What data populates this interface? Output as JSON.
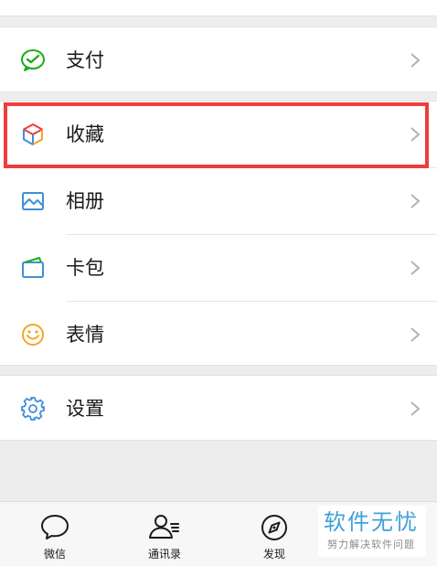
{
  "menu": {
    "items": [
      {
        "label": "支付",
        "icon": "wechat-pay-icon"
      },
      {
        "label": "收藏",
        "icon": "favorites-cube-icon"
      },
      {
        "label": "相册",
        "icon": "photo-album-icon"
      },
      {
        "label": "卡包",
        "icon": "card-wallet-icon"
      },
      {
        "label": "表情",
        "icon": "sticker-smiley-icon"
      },
      {
        "label": "设置",
        "icon": "settings-gear-icon"
      }
    ]
  },
  "tabbar": {
    "tabs": [
      {
        "label": "微信",
        "icon": "chat-bubble-icon"
      },
      {
        "label": "通讯录",
        "icon": "contacts-icon"
      },
      {
        "label": "发现",
        "icon": "compass-icon"
      }
    ]
  },
  "watermark": {
    "title": "软件无忧",
    "subtitle": "努力解决软件问题"
  },
  "colors": {
    "highlight": "#f03c3c",
    "pay_green": "#1aad19",
    "blue": "#3f8fd8",
    "orange": "#f5a623",
    "watermark": "#3fa0d8"
  }
}
